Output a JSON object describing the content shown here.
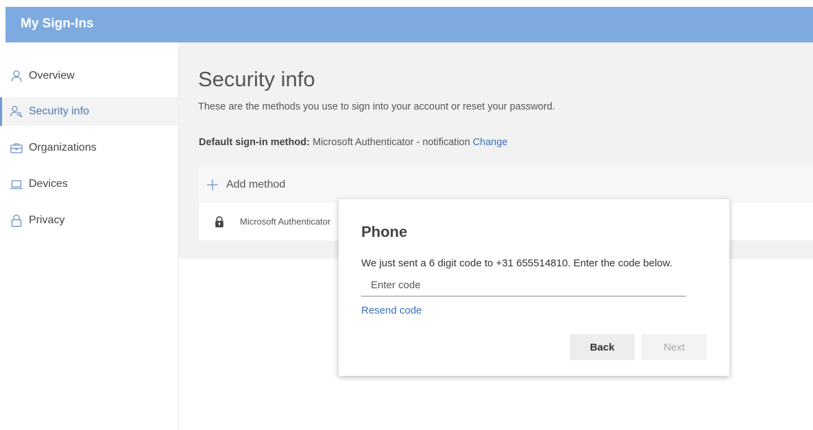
{
  "header": {
    "title": "My Sign-Ins",
    "background_color": "#7eaae0"
  },
  "sidebar": {
    "items": [
      {
        "label": "Overview",
        "icon": "person-icon"
      },
      {
        "label": "Security info",
        "icon": "person-key-icon",
        "active": true
      },
      {
        "label": "Organizations",
        "icon": "briefcase-icon"
      },
      {
        "label": "Devices",
        "icon": "laptop-icon"
      },
      {
        "label": "Privacy",
        "icon": "lock-icon"
      }
    ],
    "active_color": "#4a78b4"
  },
  "main": {
    "title": "Security info",
    "description": "These are the methods you use to sign into your account or reset your password.",
    "default_method": {
      "label": "Default sign-in method:",
      "value": " Microsoft Authenticator - notification ",
      "change_link": "Change"
    },
    "add_method_label": "Add method",
    "methods": [
      {
        "name": "Microsoft Authenticator",
        "icon": "authenticator-lock-icon"
      }
    ]
  },
  "dialog": {
    "title": "Phone",
    "message": "We just sent a 6 digit code to +31 655514810. Enter the code below.",
    "code_input": {
      "value": "",
      "placeholder": "Enter code"
    },
    "resend_link": "Resend code",
    "back_button": "Back",
    "next_button": "Next",
    "link_color": "#3a6fbf"
  }
}
